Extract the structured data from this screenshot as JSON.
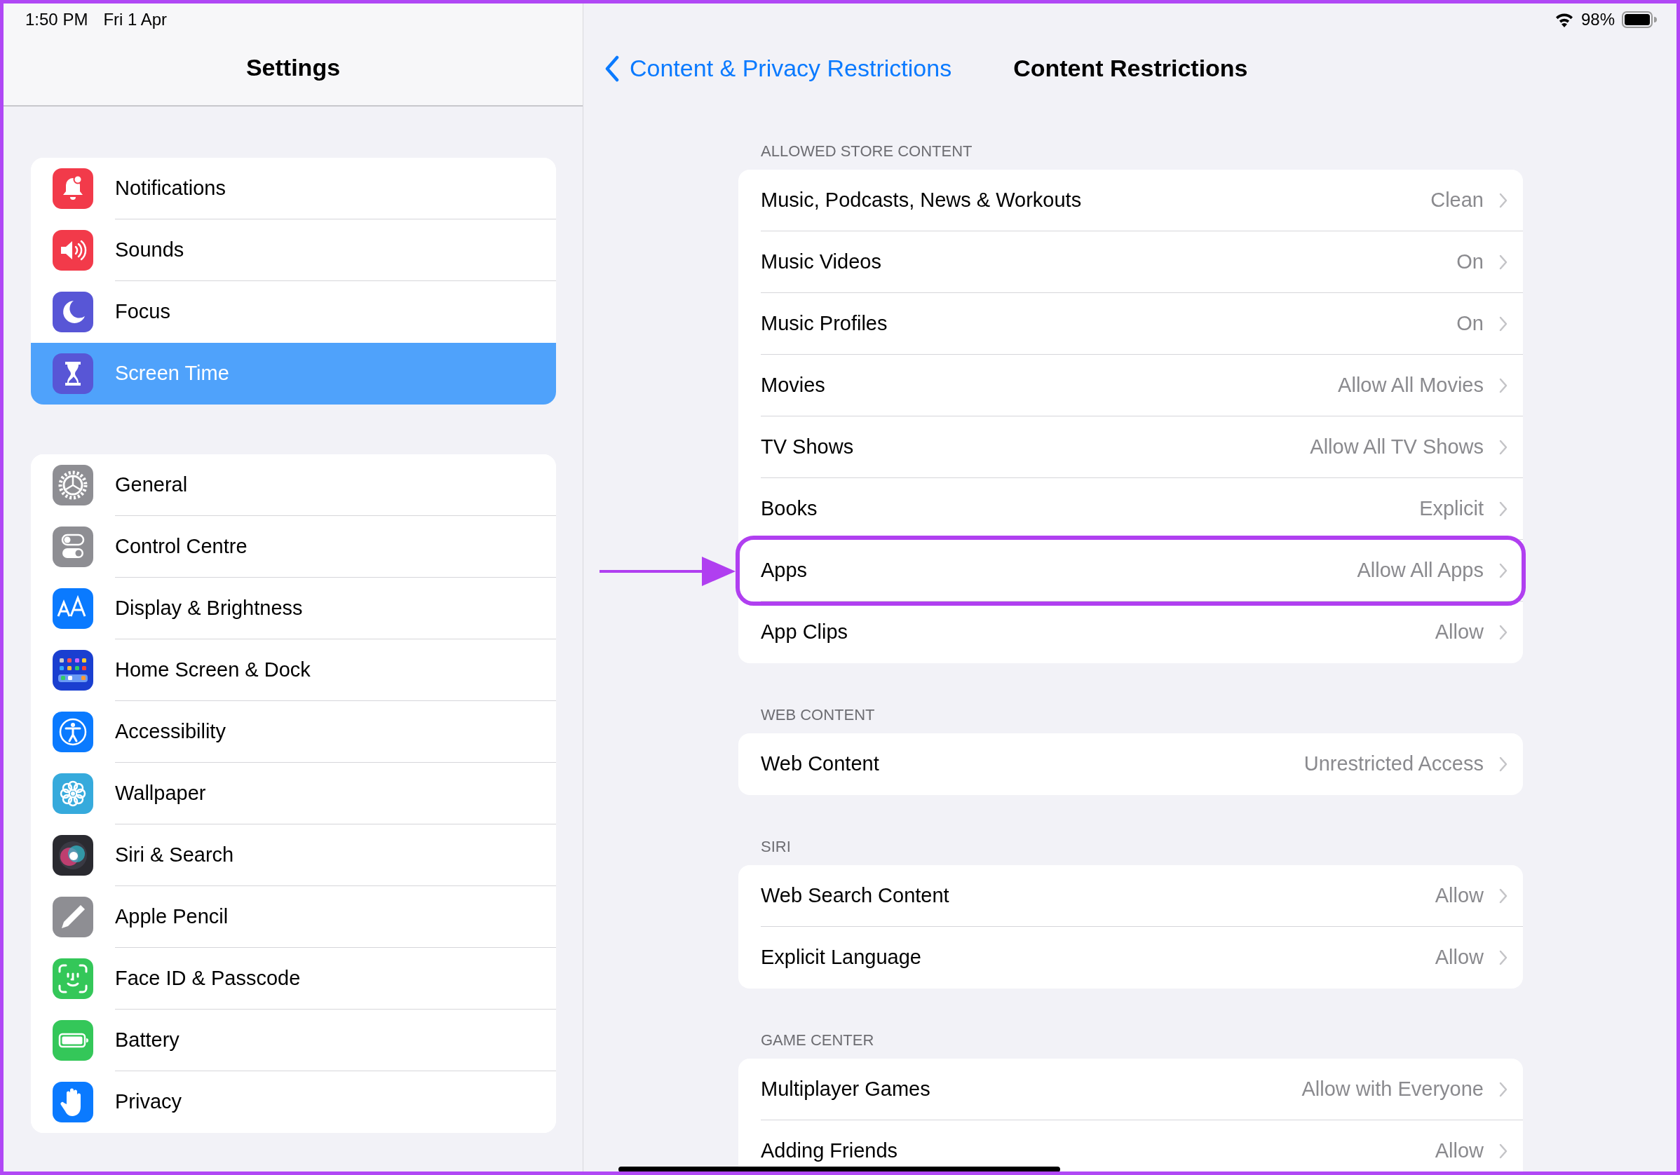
{
  "status_bar": {
    "time": "1:50 PM",
    "date": "Fri 1 Apr",
    "battery": "98%"
  },
  "sidebar": {
    "title": "Settings",
    "groups": [
      [
        {
          "label": "Notifications",
          "color": "#f23a4a",
          "selected": false
        },
        {
          "label": "Sounds",
          "color": "#f23a4a",
          "selected": false
        },
        {
          "label": "Focus",
          "color": "#5856d6",
          "selected": false
        },
        {
          "label": "Screen Time",
          "color": "#5856d6",
          "selected": true
        }
      ],
      [
        {
          "label": "General",
          "color": "#8e8e93",
          "selected": false
        },
        {
          "label": "Control Centre",
          "color": "#8e8e93",
          "selected": false
        },
        {
          "label": "Display & Brightness",
          "color": "#0a7aff",
          "selected": false
        },
        {
          "label": "Home Screen & Dock",
          "color": "#1a3fd0",
          "selected": false
        },
        {
          "label": "Accessibility",
          "color": "#0a7aff",
          "selected": false
        },
        {
          "label": "Wallpaper",
          "color": "#36aadc",
          "selected": false
        },
        {
          "label": "Siri & Search",
          "color": "#2a2a30",
          "selected": false
        },
        {
          "label": "Apple Pencil",
          "color": "#8e8e93",
          "selected": false
        },
        {
          "label": "Face ID & Passcode",
          "color": "#34c759",
          "selected": false
        },
        {
          "label": "Battery",
          "color": "#34c759",
          "selected": false
        },
        {
          "label": "Privacy",
          "color": "#0a7aff",
          "selected": false
        }
      ]
    ]
  },
  "nav": {
    "back": "Content & Privacy Restrictions",
    "title": "Content Restrictions"
  },
  "sections": [
    {
      "header": "ALLOWED STORE CONTENT",
      "rows": [
        {
          "label": "Music, Podcasts, News & Workouts",
          "value": "Clean",
          "highlighted": false
        },
        {
          "label": "Music Videos",
          "value": "On",
          "highlighted": false
        },
        {
          "label": "Music Profiles",
          "value": "On",
          "highlighted": false
        },
        {
          "label": "Movies",
          "value": "Allow All Movies",
          "highlighted": false
        },
        {
          "label": "TV Shows",
          "value": "Allow All TV Shows",
          "highlighted": false
        },
        {
          "label": "Books",
          "value": "Explicit",
          "highlighted": false
        },
        {
          "label": "Apps",
          "value": "Allow All Apps",
          "highlighted": true
        },
        {
          "label": "App Clips",
          "value": "Allow",
          "highlighted": false
        }
      ]
    },
    {
      "header": "WEB CONTENT",
      "rows": [
        {
          "label": "Web Content",
          "value": "Unrestricted Access",
          "highlighted": false
        }
      ]
    },
    {
      "header": "SIRI",
      "rows": [
        {
          "label": "Web Search Content",
          "value": "Allow",
          "highlighted": false
        },
        {
          "label": "Explicit Language",
          "value": "Allow",
          "highlighted": false
        }
      ]
    },
    {
      "header": "GAME CENTER",
      "rows": [
        {
          "label": "Multiplayer Games",
          "value": "Allow with Everyone",
          "highlighted": false
        },
        {
          "label": "Adding Friends",
          "value": "Allow",
          "highlighted": false
        }
      ]
    }
  ]
}
